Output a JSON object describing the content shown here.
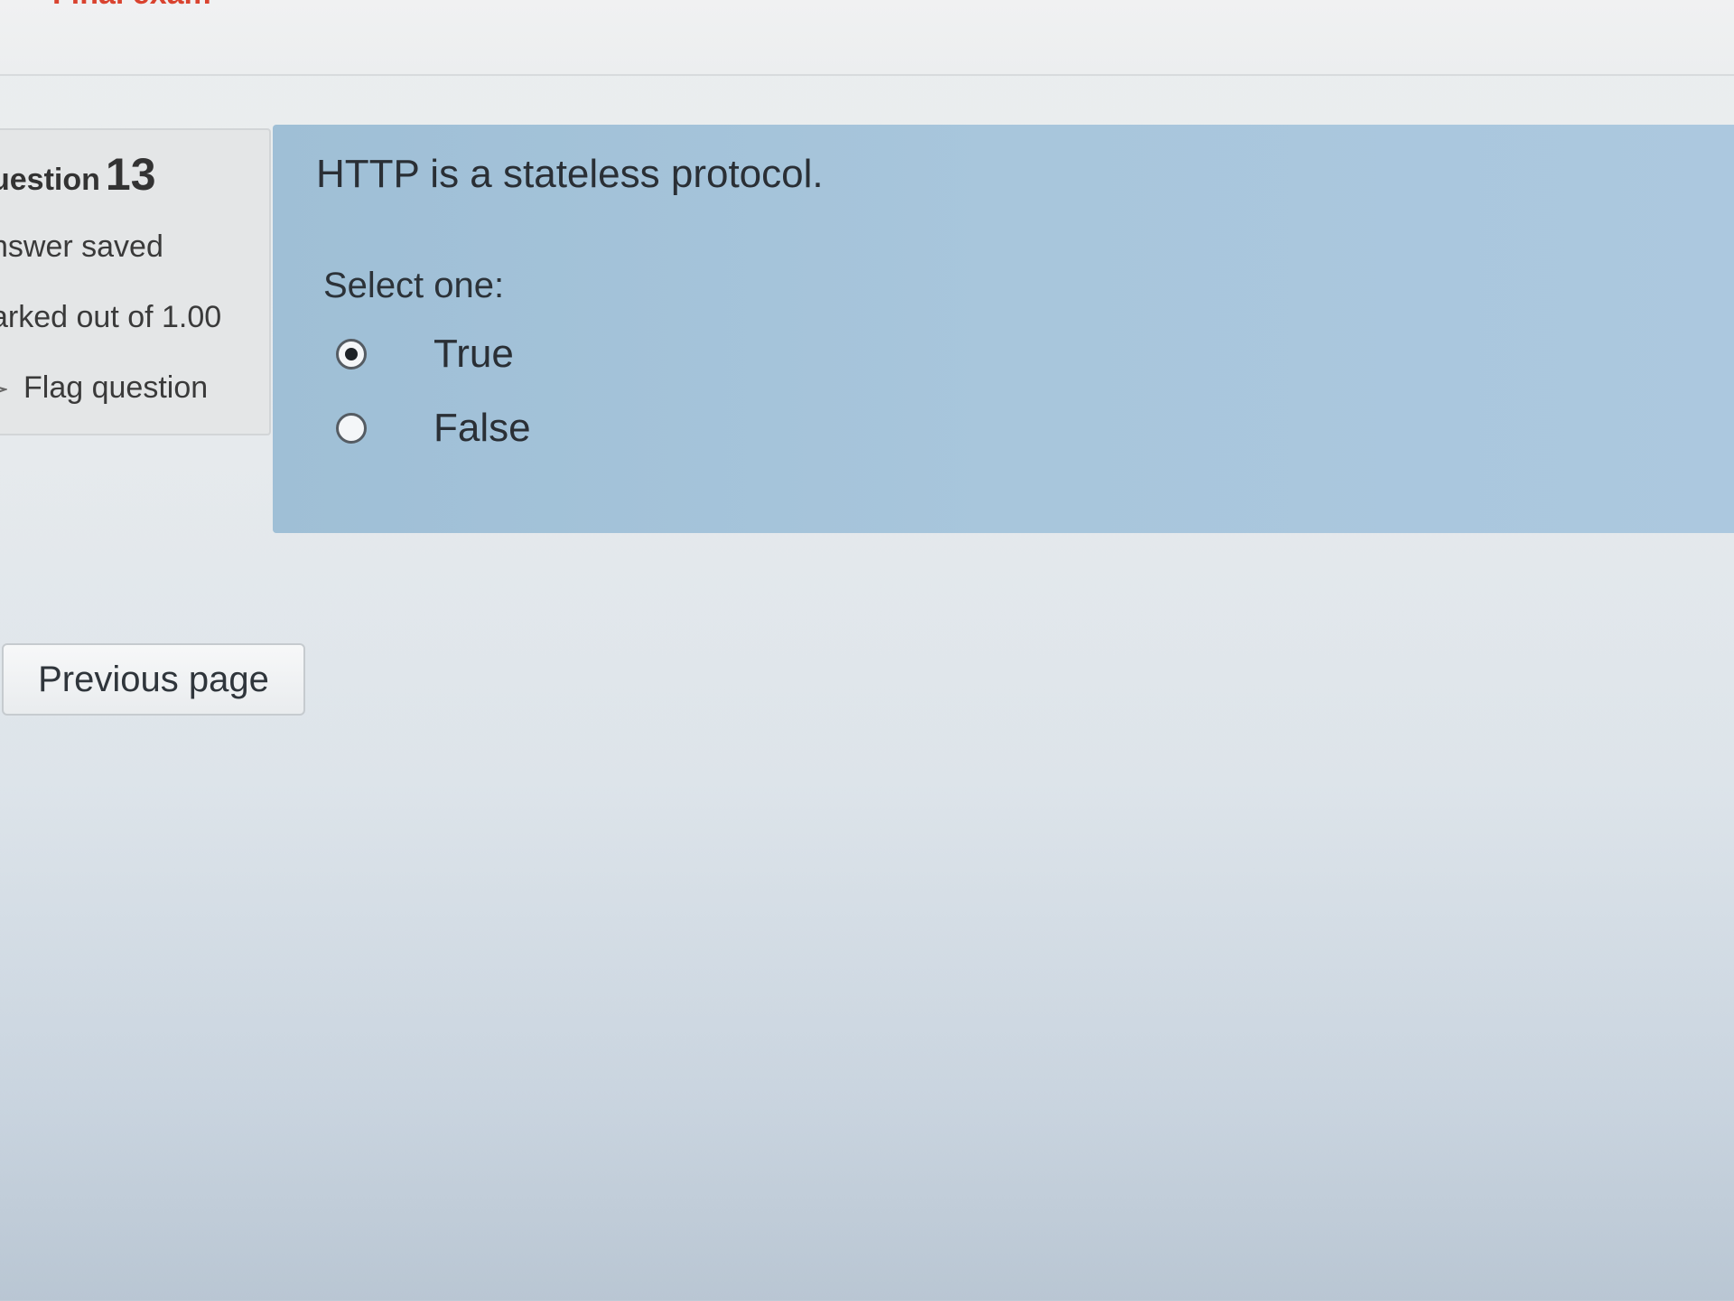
{
  "header": {
    "title_partial": "Final exam"
  },
  "question_info": {
    "label": "uestion",
    "number": "13",
    "state": "nswer saved",
    "grade": "arked out of 1.00",
    "flag_label": "Flag question",
    "flag_icon": "flag-icon"
  },
  "question": {
    "text": "HTTP is a stateless protocol.",
    "prompt": "Select one:",
    "options": [
      {
        "label": "True",
        "selected": true
      },
      {
        "label": "False",
        "selected": false
      }
    ],
    "colors": {
      "content_background": "#a8c6dc",
      "info_background": "#e4e6e7",
      "title_accent": "#d9432f"
    }
  },
  "navigation": {
    "previous_label": "Previous page"
  }
}
